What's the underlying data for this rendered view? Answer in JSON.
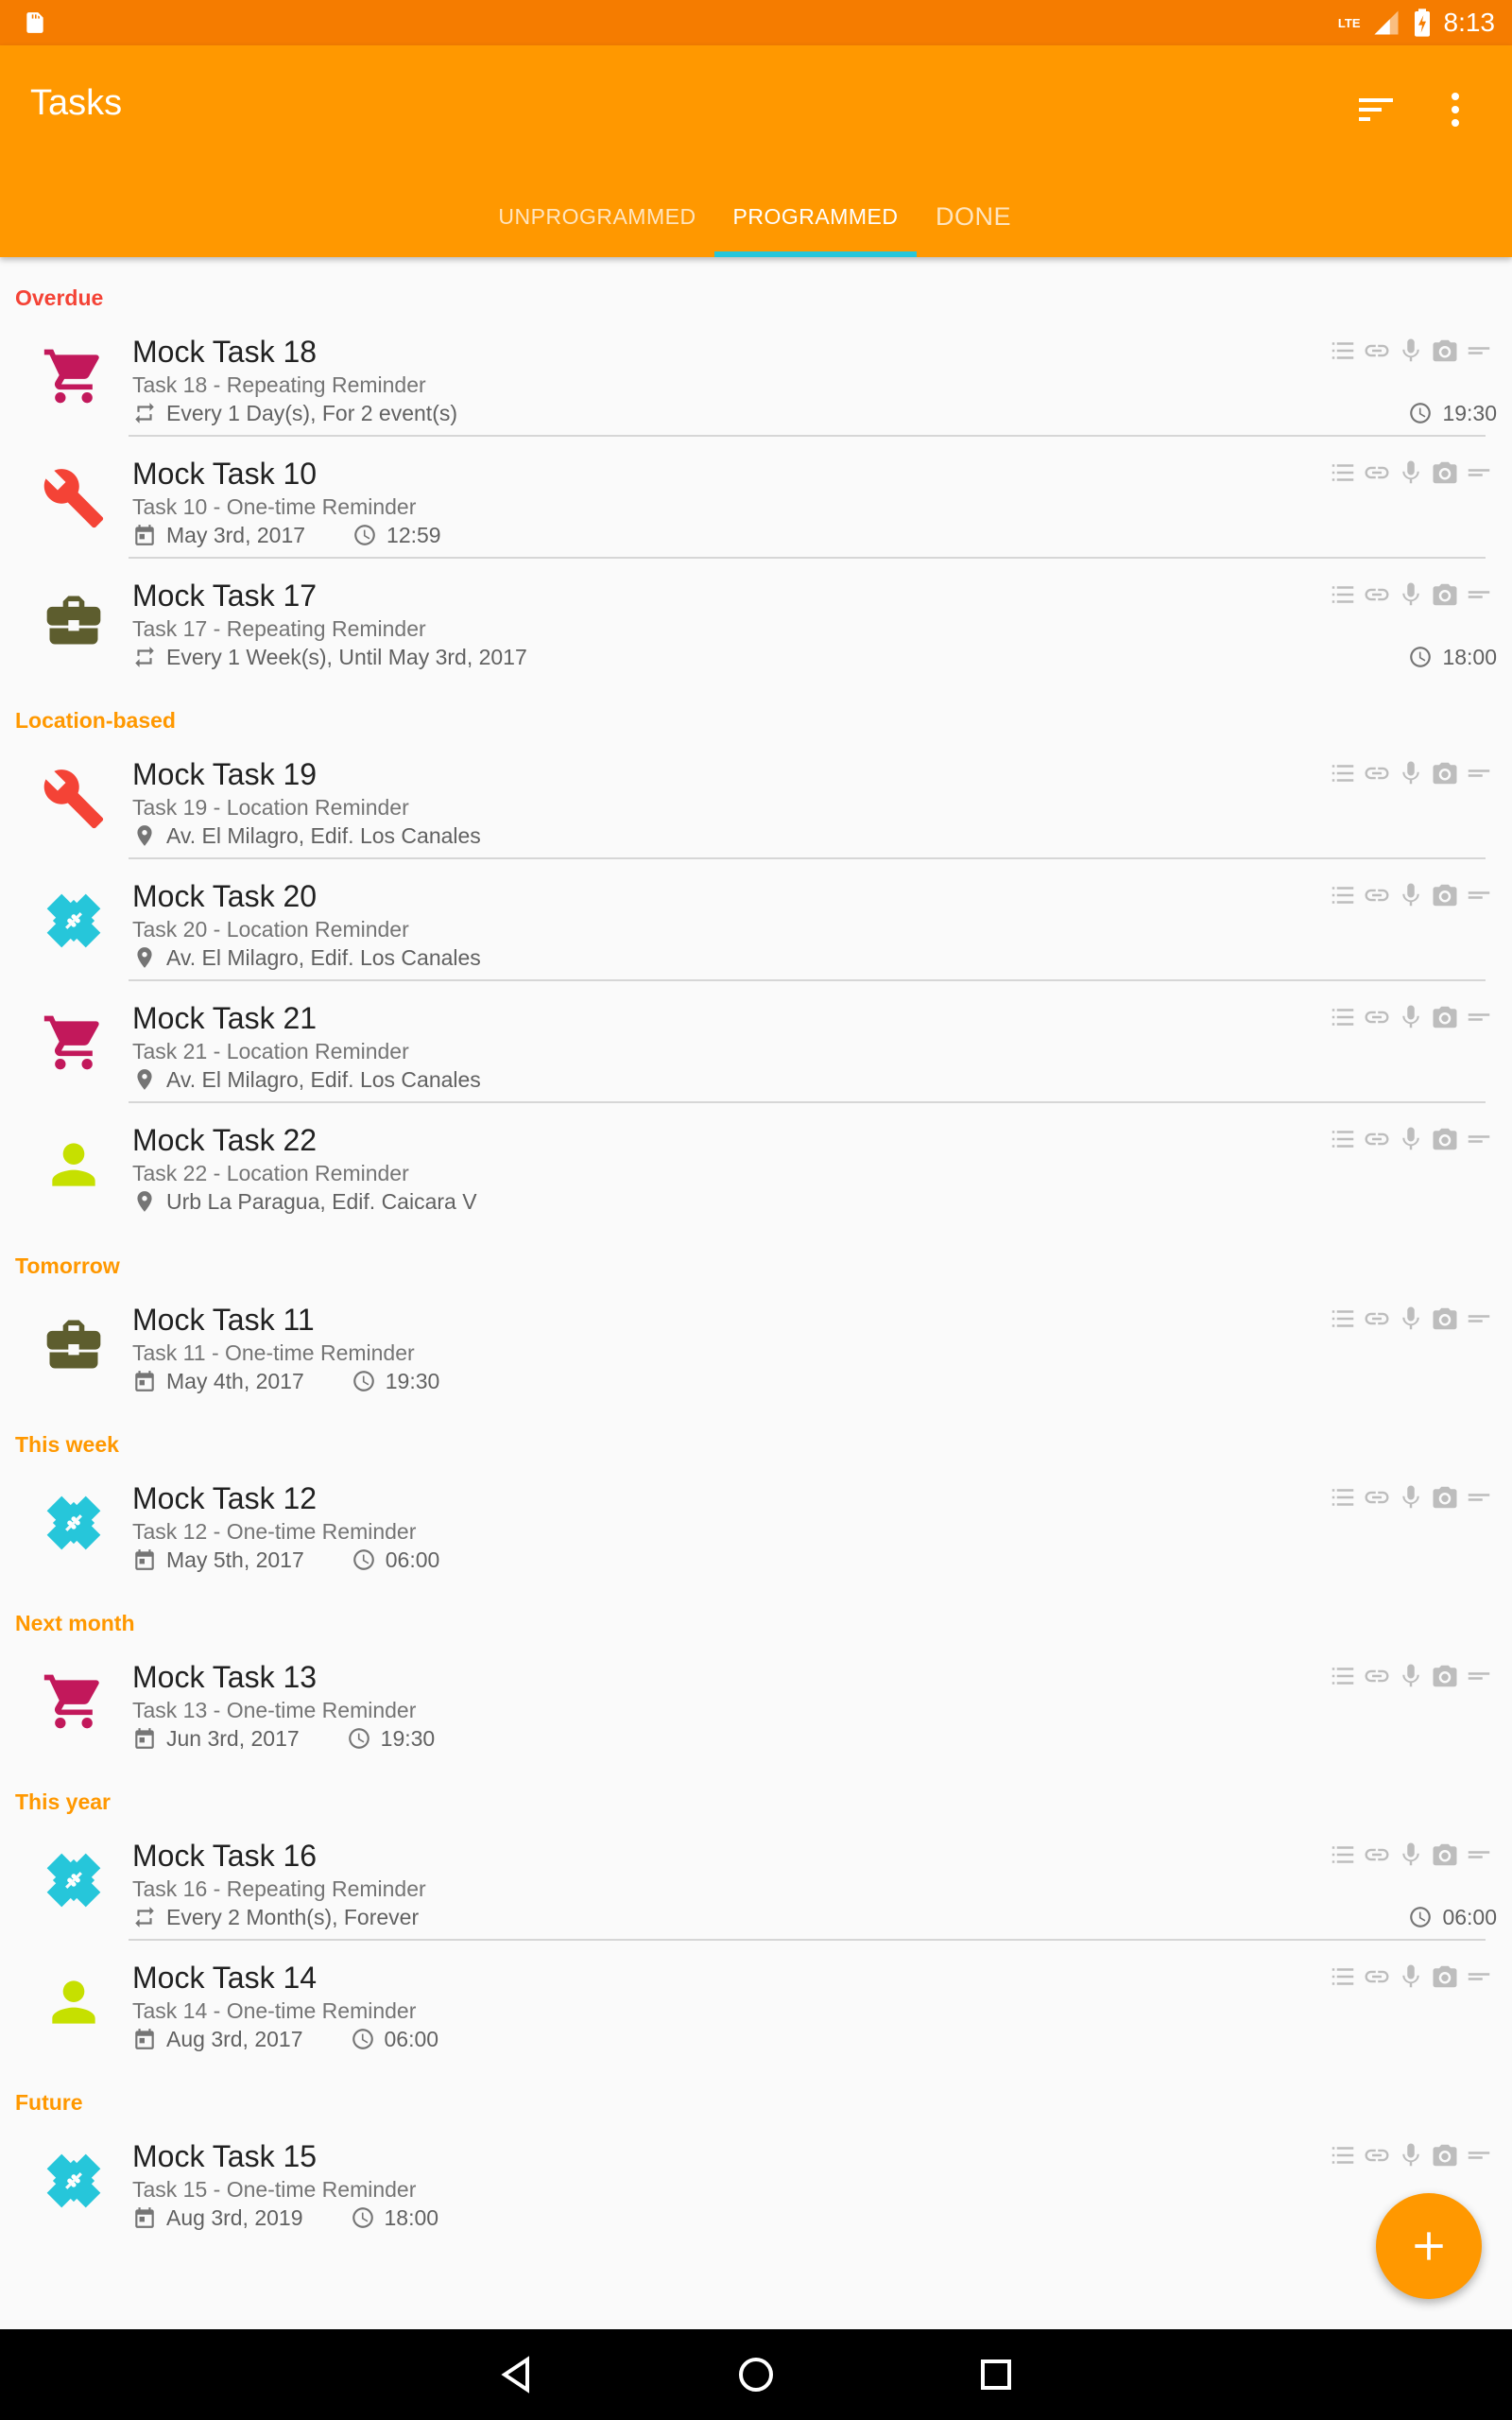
{
  "status_bar": {
    "time": "8:13",
    "network": "LTE"
  },
  "app_bar": {
    "title": "Tasks"
  },
  "tabs": [
    {
      "label": "UNPROGRAMMED"
    },
    {
      "label": "PROGRAMMED"
    },
    {
      "label": "DONE"
    }
  ],
  "active_tab": "PROGRAMMED",
  "colors": {
    "primary": "#ff9800",
    "primary_dark": "#f57c00",
    "tab_indicator": "#26c6da",
    "overdue": "#f44336",
    "section": "#ff9800",
    "cat_shopping": "#c2185b",
    "cat_repair": "#f44336",
    "cat_work": "#5d5d2e",
    "cat_health": "#26c6da",
    "cat_personal": "#c6e000"
  },
  "sections": [
    {
      "title": "Overdue",
      "color": "#f44336"
    },
    {
      "title": "Location-based",
      "color": "#ff9800"
    },
    {
      "title": "Tomorrow",
      "color": "#ff9800"
    },
    {
      "title": "This week",
      "color": "#ff9800"
    },
    {
      "title": "Next month",
      "color": "#ff9800"
    },
    {
      "title": "This year",
      "color": "#ff9800"
    },
    {
      "title": "Future",
      "color": "#ff9800"
    }
  ],
  "tasks": [
    {
      "title": "Mock Task 18",
      "subtitle": "Task 18 - Repeating Reminder",
      "meta": "Every 1 Day(s), For 2 event(s)",
      "time": "19:30",
      "icon": "shopping-cart-icon",
      "meta_icon": "repeat-icon"
    },
    {
      "title": "Mock Task 10",
      "subtitle": "Task 10 - One-time Reminder",
      "date": "May 3rd, 2017",
      "time": "12:59",
      "icon": "wrench-icon",
      "meta_icon": "calendar-icon"
    },
    {
      "title": "Mock Task 17",
      "subtitle": "Task 17 - Repeating Reminder",
      "meta": "Every 1 Week(s), Until May 3rd, 2017",
      "time": "18:00",
      "icon": "briefcase-icon",
      "meta_icon": "repeat-icon"
    },
    {
      "title": "Mock Task 19",
      "subtitle": "Task 19 - Location Reminder",
      "meta": "Av. El Milagro, Edif. Los Canales",
      "icon": "wrench-icon",
      "meta_icon": "location-pin-icon"
    },
    {
      "title": "Mock Task 20",
      "subtitle": "Task 20 - Location Reminder",
      "meta": "Av. El Milagro, Edif. Los Canales",
      "icon": "bandage-icon",
      "meta_icon": "location-pin-icon"
    },
    {
      "title": "Mock Task 21",
      "subtitle": "Task 21 - Location Reminder",
      "meta": "Av. El Milagro, Edif. Los Canales",
      "icon": "shopping-cart-icon",
      "meta_icon": "location-pin-icon"
    },
    {
      "title": "Mock Task 22",
      "subtitle": "Task 22 - Location Reminder",
      "meta": "Urb La Paragua, Edif. Caicara V",
      "icon": "person-icon",
      "meta_icon": "location-pin-icon"
    },
    {
      "title": "Mock Task 11",
      "subtitle": "Task 11 - One-time Reminder",
      "date": "May 4th, 2017",
      "time": "19:30",
      "icon": "briefcase-icon",
      "meta_icon": "calendar-icon"
    },
    {
      "title": "Mock Task 12",
      "subtitle": "Task 12 - One-time Reminder",
      "date": "May 5th, 2017",
      "time": "06:00",
      "icon": "bandage-icon",
      "meta_icon": "calendar-icon"
    },
    {
      "title": "Mock Task 13",
      "subtitle": "Task 13 - One-time Reminder",
      "date": "Jun 3rd, 2017",
      "time": "19:30",
      "icon": "shopping-cart-icon",
      "meta_icon": "calendar-icon"
    },
    {
      "title": "Mock Task 16",
      "subtitle": "Task 16 - Repeating Reminder",
      "meta": "Every 2 Month(s), Forever",
      "time": "06:00",
      "icon": "bandage-icon",
      "meta_icon": "repeat-icon"
    },
    {
      "title": "Mock Task 14",
      "subtitle": "Task 14 - One-time Reminder",
      "date": "Aug 3rd, 2017",
      "time": "06:00",
      "icon": "person-icon",
      "meta_icon": "calendar-icon"
    },
    {
      "title": "Mock Task 15",
      "subtitle": "Task 15 - One-time Reminder",
      "date": "Aug 3rd, 2019",
      "time": "18:00",
      "icon": "bandage-icon",
      "meta_icon": "calendar-icon"
    }
  ],
  "attachment_icons": [
    "checklist-icon",
    "link-icon",
    "microphone-icon",
    "camera-icon",
    "notes-icon"
  ],
  "fab": {
    "icon": "plus-icon"
  },
  "nav_bar": {
    "icons": [
      "back-icon",
      "home-icon",
      "recents-icon"
    ]
  }
}
